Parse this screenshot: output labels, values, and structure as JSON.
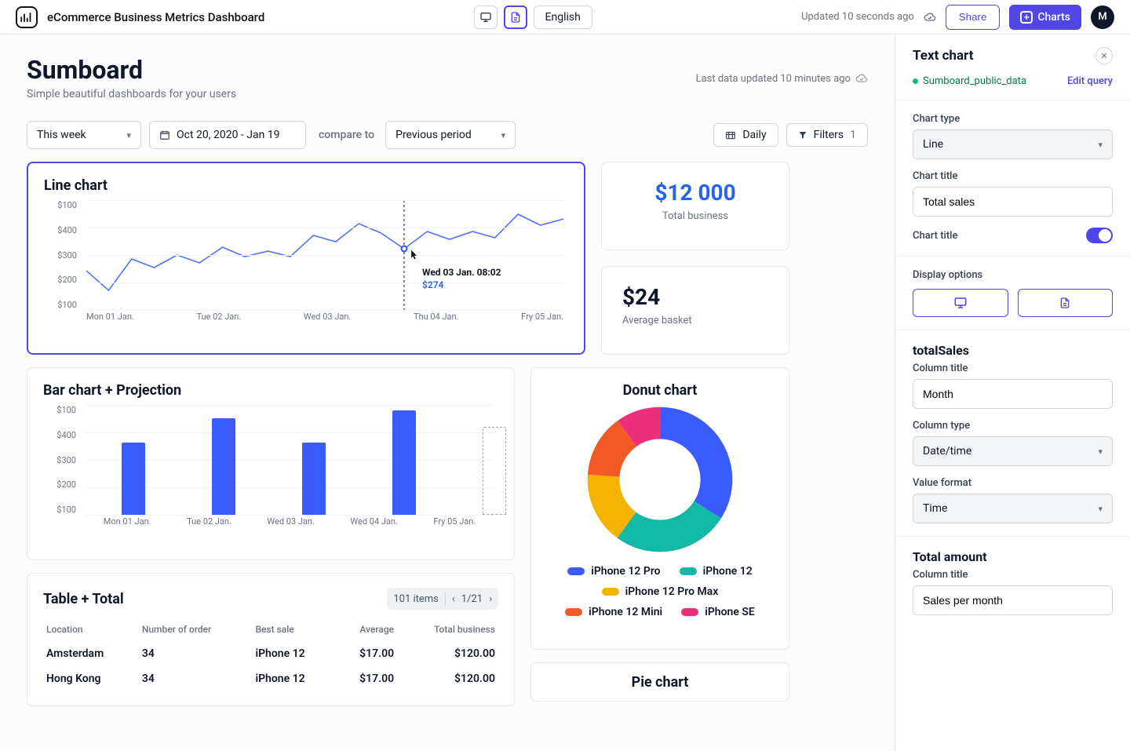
{
  "header": {
    "app_title": "eCommerce Business Metrics Dashboard",
    "language": "English",
    "updated": "Updated 10 seconds ago",
    "share": "Share",
    "charts": "Charts",
    "avatar": "M"
  },
  "page": {
    "title": "Sumboard",
    "subtitle": "Simple beautiful dashboards for your users",
    "last_updated": "Last data updated 10 minutes ago"
  },
  "controls": {
    "range_label": "This week",
    "date_range": "Oct 20, 2020 - Jan 19",
    "compare_label": "compare to",
    "compare_value": "Previous period",
    "frequency": "Daily",
    "filters_label": "Filters",
    "filters_count": "1"
  },
  "kpis": {
    "total_business": {
      "value": "$12 000",
      "label": "Total business"
    },
    "avg_basket": {
      "value": "$24",
      "label": "Average basket"
    }
  },
  "line_card": {
    "title": "Line chart",
    "tooltip_date": "Wed 03 Jan. 08:02",
    "tooltip_value": "$274"
  },
  "bar_card": {
    "title": "Bar chart + Projection"
  },
  "donut_card": {
    "title": "Donut chart"
  },
  "table_card": {
    "title": "Table + Total",
    "items": "101 items",
    "page": "1/21",
    "cols": [
      "Location",
      "Number of order",
      "Best sale",
      "Average",
      "Total business"
    ],
    "rows": [
      [
        "Amsterdam",
        "34",
        "iPhone 12",
        "$17.00",
        "$120.00"
      ],
      [
        "Hong Kong",
        "34",
        "iPhone 12",
        "$17.00",
        "$120.00"
      ]
    ]
  },
  "pie_card": {
    "title": "Pie chart"
  },
  "side": {
    "title": "Text chart",
    "source": "Sumboard_public_data",
    "edit_query": "Edit query",
    "chart_type_label": "Chart type",
    "chart_type_value": "Line",
    "chart_title_label": "Chart title",
    "chart_title_value": "Total sales",
    "chart_title_toggle_label": "Chart title",
    "display_options_label": "Display options",
    "section2": "totalSales",
    "column_title_label": "Column title",
    "column_title_value": "Month",
    "column_type_label": "Column type",
    "column_type_value": "Date/time",
    "value_format_label": "Value format",
    "value_format_value": "Time",
    "section3": "Total amount",
    "column_title2_label": "Column title",
    "column_title2_value": "Sales per month"
  },
  "chart_data": [
    {
      "type": "line",
      "title": "Line chart",
      "y_ticks": [
        "$100",
        "$400",
        "$300",
        "$200",
        "$100"
      ],
      "x_ticks": [
        "Mon 01 Jan.",
        "Tue 02 Jan.",
        "Wed 03 Jan.",
        "Thu 04 Jan.",
        "Fry 05 Jan."
      ],
      "series": [
        {
          "name": "value",
          "values": [
            210,
            140,
            250,
            220,
            260,
            235,
            290,
            260,
            280,
            260,
            340,
            320,
            380,
            350,
            274,
            360,
            330,
            360,
            335,
            400,
            370,
            395
          ]
        }
      ],
      "highlight": {
        "x_index": 14,
        "label": "Wed 03 Jan. 08:02",
        "value": 274
      }
    },
    {
      "type": "bar",
      "title": "Bar chart + Projection",
      "y_ticks": [
        "$100",
        "$400",
        "$300",
        "$200",
        "$100"
      ],
      "categories": [
        "Mon 01 Jan.",
        "Tue 02 Jan.",
        "Wed 03 Jan.",
        "Wed 04 Jan.",
        "Fry 05 Jan."
      ],
      "values": [
        330,
        440,
        330,
        475,
        null
      ],
      "projection_index": 4,
      "projection_value": 400
    },
    {
      "type": "pie",
      "title": "Donut chart",
      "series": [
        {
          "name": "iPhone 12 Pro",
          "value": 34,
          "color": "#3b5bfd"
        },
        {
          "name": "iPhone 12",
          "value": 26,
          "color": "#14b8a6"
        },
        {
          "name": "iPhone 12 Pro Max",
          "value": 16,
          "color": "#f5b301"
        },
        {
          "name": "iPhone 12 Mini",
          "value": 14,
          "color": "#f15a24"
        },
        {
          "name": "iPhone SE",
          "value": 10,
          "color": "#ec2f7b"
        }
      ]
    }
  ]
}
